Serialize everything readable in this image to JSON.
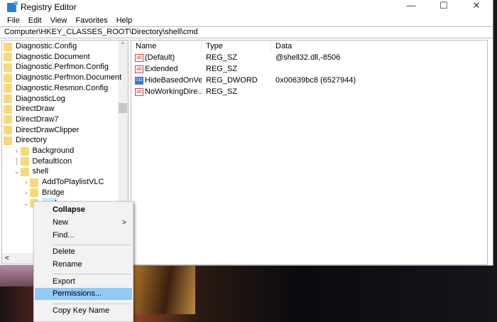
{
  "window": {
    "title": "Registry Editor",
    "minimize": "—",
    "maximize": "☐",
    "close": "✕"
  },
  "menu": [
    "File",
    "Edit",
    "View",
    "Favorites",
    "Help"
  ],
  "address": "Computer\\HKEY_CLASSES_ROOT\\Directory\\shell\\cmd",
  "tree": [
    {
      "label": "Diagnostic.Config",
      "level": 0
    },
    {
      "label": "Diagnostic.Document",
      "level": 0
    },
    {
      "label": "Diagnostic.Perfmon.Config",
      "level": 0
    },
    {
      "label": "Diagnostic.Perfmon.Document",
      "level": 0
    },
    {
      "label": "Diagnostic.Resmon.Config",
      "level": 0
    },
    {
      "label": "DiagnosticLog",
      "level": 0
    },
    {
      "label": "DirectDraw",
      "level": 0
    },
    {
      "label": "DirectDraw7",
      "level": 0
    },
    {
      "label": "DirectDrawClipper",
      "level": 0
    },
    {
      "label": "Directory",
      "level": 0
    },
    {
      "label": "Background",
      "level": 1,
      "chevron": ">"
    },
    {
      "label": "DefaultIcon",
      "level": 1
    },
    {
      "label": "shell",
      "level": 1,
      "chevron": "v"
    },
    {
      "label": "AddToPlaylistVLC",
      "level": 2,
      "chevron": ">"
    },
    {
      "label": "Bridge",
      "level": 2,
      "chevron": ">"
    },
    {
      "label": "cmd",
      "level": 2,
      "chevron": "v",
      "selected": true
    }
  ],
  "hscroll_left": "<",
  "values": {
    "headers": [
      "Name",
      "Type",
      "Data"
    ],
    "rows": [
      {
        "name": "(Default)",
        "type": "REG_SZ",
        "data": "@shell32.dll,-8506",
        "icon": "ab"
      },
      {
        "name": "Extended",
        "type": "REG_SZ",
        "data": "",
        "icon": "ab"
      },
      {
        "name": "HideBasedOnVel...",
        "type": "REG_DWORD",
        "data": "0x00639bc8 (6527944)",
        "icon": "bin"
      },
      {
        "name": "NoWorkingDire...",
        "type": "REG_SZ",
        "data": "",
        "icon": "ab"
      }
    ]
  },
  "context_menu": {
    "items": [
      "Collapse",
      "New",
      "Find...",
      "Delete",
      "Rename",
      "Export",
      "Permissions...",
      "Copy Key Name"
    ],
    "submenu_arrow": ">",
    "highlighted": "Permissions..."
  }
}
